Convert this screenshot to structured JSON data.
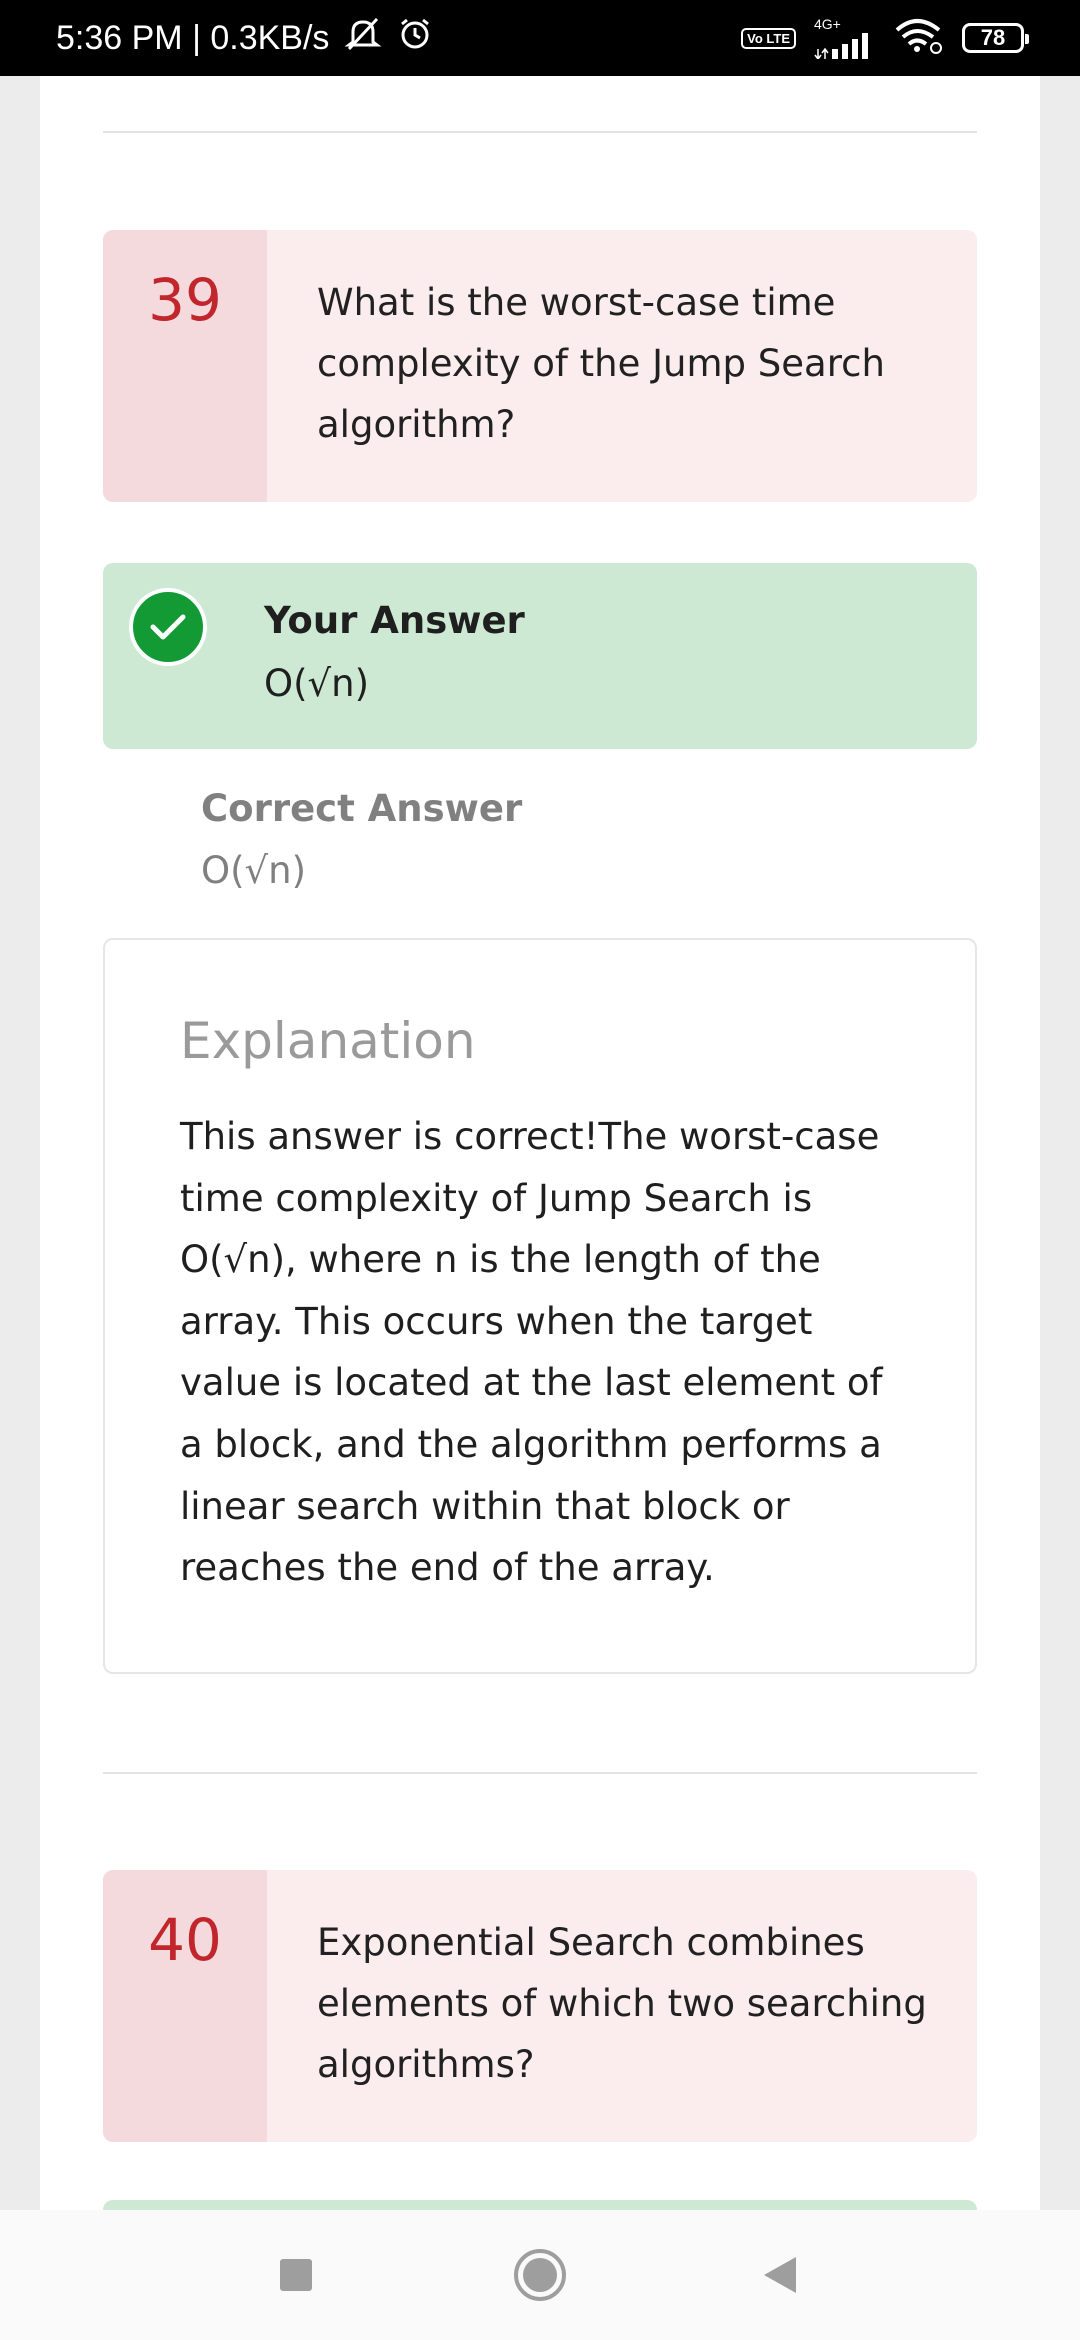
{
  "status_bar": {
    "time_speed": "5:36 PM | 0.3KB/s",
    "volte": "Vo LTE",
    "network": "4G+",
    "battery": "78"
  },
  "questions": [
    {
      "number": "39",
      "text": "What is the worst-case time complexity of the Jump Search algorithm?",
      "your_answer_label": "Your Answer",
      "your_answer": "O(√n)",
      "correct_answer_label": "Correct Answer",
      "correct_answer": "O(√n)",
      "explanation_title": "Explanation",
      "explanation": "This answer is correct!The worst-case time complexity of Jump Search is O(√n), where n is the length of the array. This occurs when the target value is located at the last element of a block, and the algorithm performs a linear search within that block or reaches the end of the array."
    },
    {
      "number": "40",
      "text": "Exponential Search combines elements of which two searching algorithms?"
    }
  ],
  "colors": {
    "question_bg": "#fbecee",
    "question_number_bg": "#f5dadd",
    "question_number": "#c0262c",
    "correct_bg": "#cde9d4",
    "check_circle": "#139a35"
  },
  "icons": {
    "status": [
      "mute-icon",
      "alarm-icon",
      "signal-icon",
      "wifi-icon",
      "battery-icon"
    ],
    "answer": "checkmark-icon",
    "nav": [
      "recents-square-icon",
      "home-circle-icon",
      "back-triangle-icon"
    ]
  }
}
